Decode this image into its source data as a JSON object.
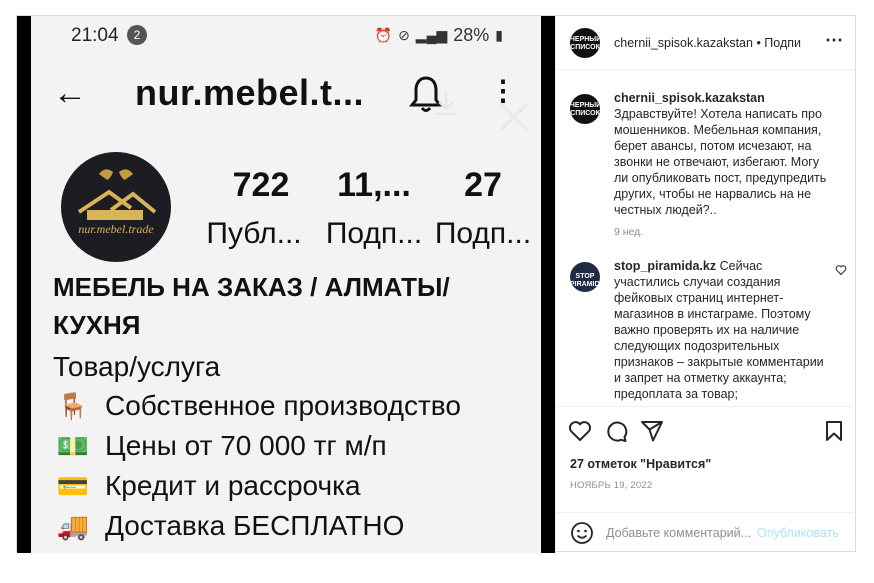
{
  "screenshot": {
    "status_bar": {
      "time": "21:04",
      "notif_count": "2",
      "battery": "28%"
    },
    "username": "nur.mebel.t...",
    "avatar_brand": "nur.mebel.trade",
    "stats": [
      {
        "value": "722",
        "label": "Публ..."
      },
      {
        "value": "11,...",
        "label": "Подп..."
      },
      {
        "value": "27",
        "label": "Подп..."
      }
    ],
    "bio_name_line1": "МЕБЕЛЬ НА ЗАКАЗ / АЛМАТЫ/",
    "bio_name_line2": "КУХНЯ",
    "category": "Товар/услуга",
    "lines": [
      {
        "emoji": "🪑",
        "text": "Собственное производство"
      },
      {
        "emoji": "💵",
        "text": "Цены от 70 000 тг м/п"
      },
      {
        "emoji": "💳",
        "text": "Кредит и рассрочка"
      },
      {
        "emoji": "🚚",
        "text": "Доставка БЕСПЛАТНО"
      }
    ]
  },
  "side": {
    "account": "chernii_spisok.kazakstan",
    "separator": " • ",
    "follow": "Подпи",
    "avatar_text": "ЧЕРНЫЙ СПИСОК",
    "comments": [
      {
        "username": "chernii_spisok.kazakstan",
        "text": "Здравствуйте! Хотела написать про мошенников. Мебельная компания, берет авансы, потом исчезают, на звонки не отвечают, избегают. Могу ли опубликовать пост, предупредить других, чтобы не нарвались на не честных людей?..",
        "age": "9 нед."
      },
      {
        "username": "stop_piramida.kz",
        "avatar_text": "STOP PIRAMIDA",
        "text": "Сейчас участились случаи создания фейковых страниц интернет-магазинов в инстаграме. Поэтому важно проверять их на наличие следующих подозрительных признаков – закрытые комментарии и запрет на отметку аккаунта; предоплата за товар;"
      }
    ],
    "likes": "27 отметок \"Нравится\"",
    "date": "НОЯБРЬ 19, 2022",
    "comment_placeholder": "Добавьте комментарий...",
    "publish": "Опубликовать"
  },
  "colors": {
    "link_disabled": "#b2dffc",
    "muted": "#8e8e8e",
    "text": "#262626"
  }
}
